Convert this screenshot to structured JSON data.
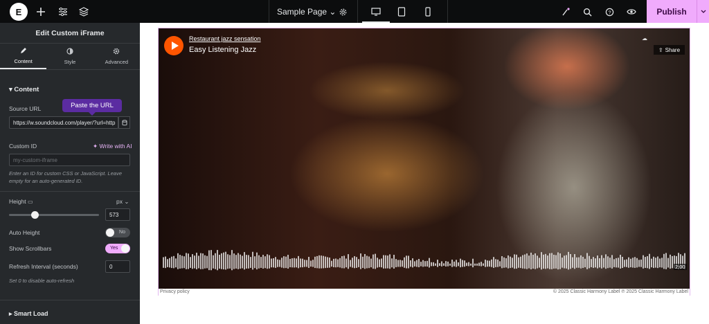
{
  "topbar": {
    "logo_letter": "E",
    "page_name": "Sample Page",
    "publish_label": "Publish"
  },
  "panel": {
    "title": "Edit Custom iFrame",
    "tabs": [
      {
        "label": "Content",
        "icon": "pencil-icon"
      },
      {
        "label": "Style",
        "icon": "half-circle-icon"
      },
      {
        "label": "Advanced",
        "icon": "gear-icon"
      }
    ],
    "section_title": "Content",
    "source_url": {
      "label": "Source URL",
      "value": "https://w.soundcloud.com/player/?url=http"
    },
    "tooltip": "Paste the URL",
    "custom_id": {
      "label": "Custom ID",
      "placeholder": "my-custom-iframe",
      "ai_label": "Write with AI"
    },
    "custom_id_help": "Enter an ID for custom CSS or JavaScript. Leave empty for an auto-generated ID.",
    "height": {
      "label": "Height",
      "unit": "px",
      "value": "573"
    },
    "auto_height": {
      "label": "Auto Height",
      "state": "No"
    },
    "show_scrollbars": {
      "label": "Show Scrollbars",
      "state": "Yes"
    },
    "refresh": {
      "label": "Refresh Interval (seconds)",
      "value": "0",
      "help": "Set 0 to disable auto-refresh"
    },
    "smart_load": "Smart Load"
  },
  "player": {
    "artist": "Restaurant jazz sensation",
    "track": "Easy Listening Jazz",
    "share_label": "Share",
    "duration": "2:00",
    "privacy": "Privacy policy",
    "copyright": "© 2025 Classic Harmony Label ℗ 2025 Classic Harmony Label",
    "accent": "#ff5500"
  }
}
